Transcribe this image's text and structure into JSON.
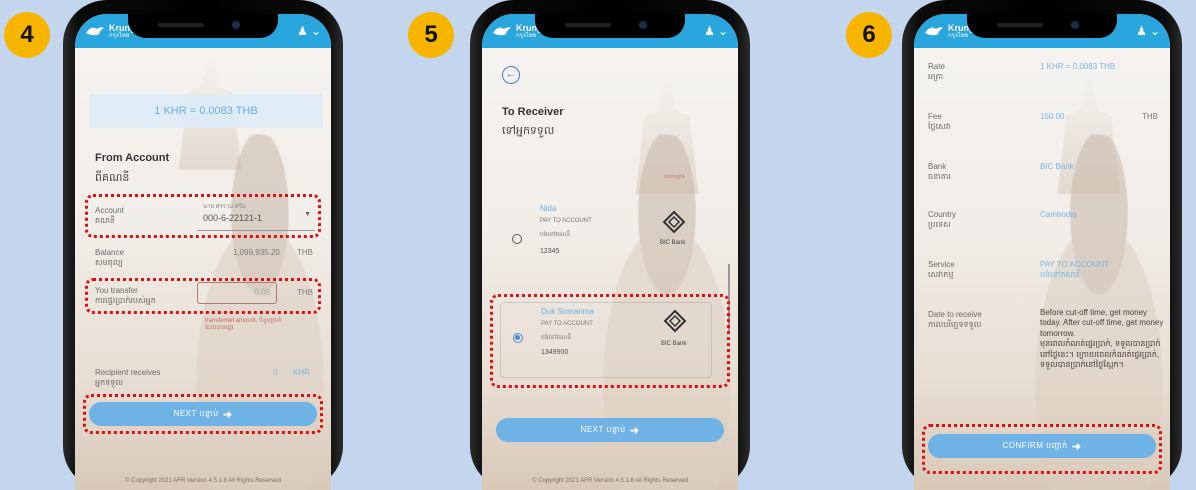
{
  "brand": {
    "name": "Krungthai",
    "name_th": "กรุงไทย",
    "short": "Krung"
  },
  "steps": [
    {
      "number": "4",
      "rate": "1 KHR = 0.0083 THB",
      "from_title": "From Account",
      "from_title_km": "ពីគណនី",
      "account_label": "Account",
      "account_label_km": "គណនី",
      "account_name": "นาย ศรราม ศรีม",
      "account_number": "000-6-22121-1",
      "balance_label": "Balance",
      "balance_label_km": "សមតុល្យ",
      "balance_value": "1,099,935.20",
      "balance_ccy": "THB",
      "transfer_label": "You transfer",
      "transfer_label_km": "ការផ្ទេរប្រាក់របស់អ្នក",
      "transfer_value": "0.00",
      "transfer_ccy": "THB",
      "transfer_note": "transferred amount, ចំនួនប្រាក់ដែលបានផ្ទេរ",
      "receive_label": "Recipient receives",
      "receive_label_km": "អ្នកទទួល",
      "receive_value": "0",
      "receive_ccy": "KHR",
      "next_label": "NEXT បន្ទាប់",
      "footer": "© Copyright 2021 AFR Version 4.5.1.8 All Rights Reserved"
    },
    {
      "number": "5",
      "to_title": "To Receiver",
      "to_title_km": "ទៅអ្នកទទួល",
      "small_caption": "ពេលបន្ទាប់",
      "receivers": [
        {
          "name": "Nida",
          "type": "PAY TO ACCOUNT",
          "type_km": "បង់ទៅគណនី",
          "number": "12345",
          "bank": "BIC Bank",
          "selected": false
        },
        {
          "name": "Duk Somarima",
          "type": "PAY TO ACCOUNT",
          "type_km": "បង់ទៅគណនី",
          "number": "1349900",
          "bank": "BIC Bank",
          "selected": true
        }
      ],
      "next_label": "NEXT បន្ទាប់",
      "footer": "© Copyright 2021 AFR Version 4.5.1.8 All Rights Reserved"
    },
    {
      "number": "6",
      "rows": [
        {
          "label": "Rate",
          "label_km": "អត្រា",
          "value": "1 KHR = 0.0083 THB",
          "suffix": ""
        },
        {
          "label": "Fee",
          "label_km": "ថ្លៃសេវា",
          "value": "150.00",
          "suffix": "THB"
        },
        {
          "label": "Bank",
          "label_km": "ធនាគារ",
          "value": "BIC Bank",
          "suffix": ""
        },
        {
          "label": "Country",
          "label_km": "ប្រទេស",
          "value": "Cambodia",
          "suffix": ""
        },
        {
          "label": "Service",
          "label_km": "សេវាកម្ម",
          "value": "PAY TO ACCOUNT",
          "value2": "បង់ទៅគណនី",
          "suffix": ""
        },
        {
          "label": "Date to receive",
          "label_km": "កាលបរិច្ឆេទទទួល",
          "value": "Before cut-off time, get money today. After cut-off time, get money tomorrow.",
          "value2": "មុនពេលកំណត់ផ្ទេរប្រាក់, ទទួលបានប្រាក់នៅថ្ងៃនេះ។ ក្រោយពេលកំណត់ផ្ទេរប្រាក់, ទទួលបានប្រាក់នៅថ្ងៃស្អែក។",
          "suffix": ""
        }
      ],
      "confirm_label": "CONFIRM បញ្ជាក់"
    }
  ]
}
